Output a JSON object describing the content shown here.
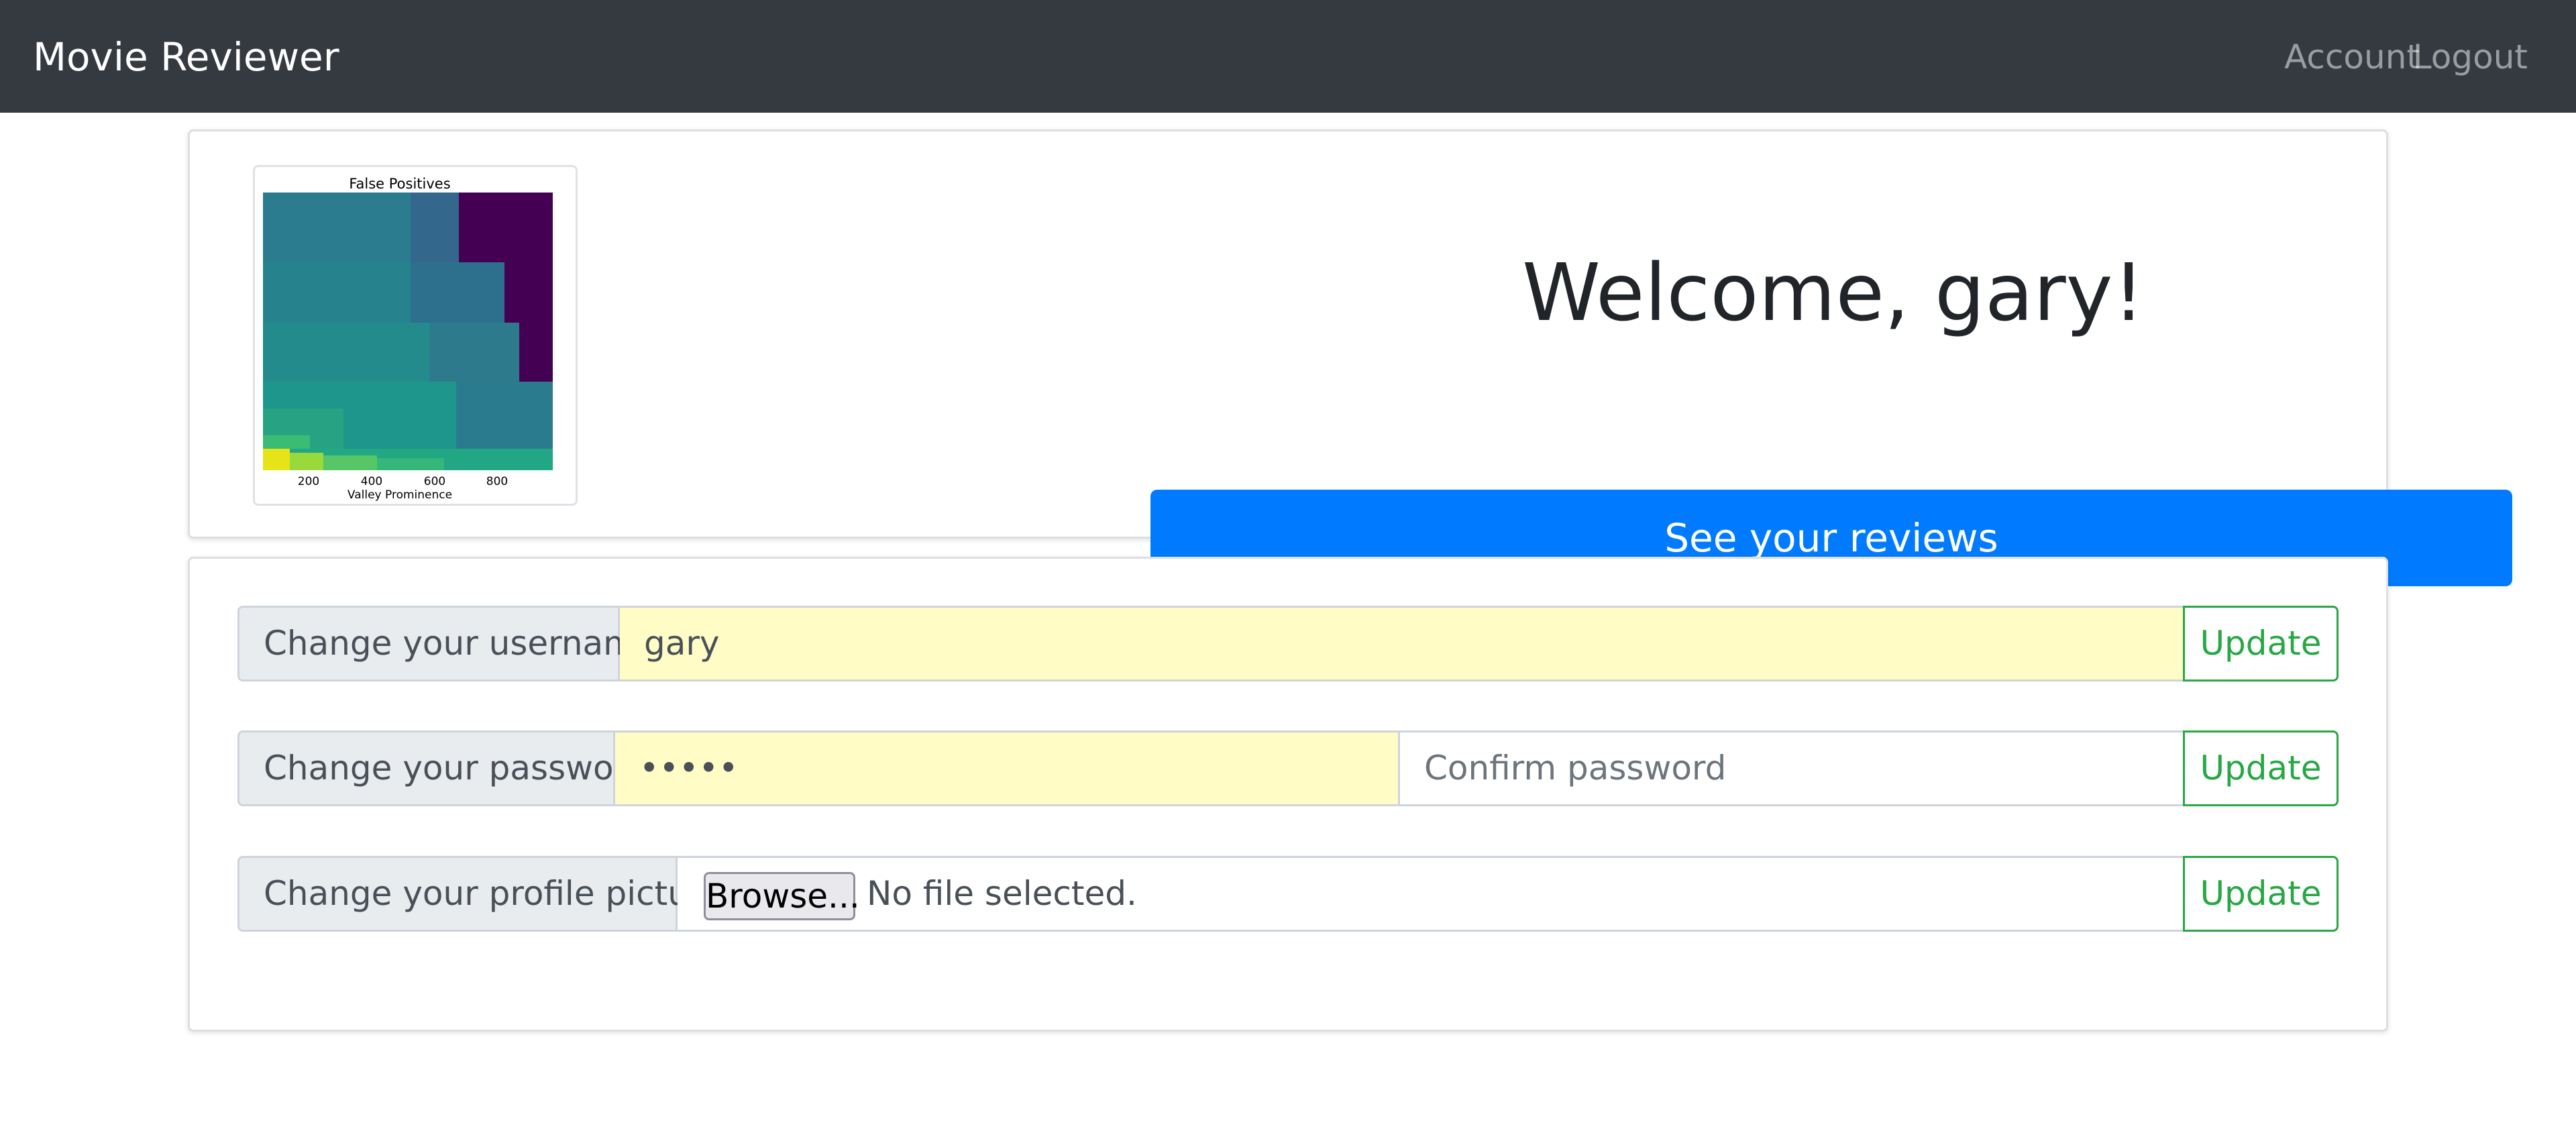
{
  "navbar": {
    "brand": "Movie Reviewer",
    "links": [
      "Account",
      "Logout"
    ]
  },
  "profile": {
    "avatar": {
      "title": "False Positives",
      "xlabel": "Valley Prominence",
      "x_ticks": [
        "200",
        "400",
        "600",
        "800"
      ],
      "colormap": "viridis"
    },
    "welcome": "Welcome, gary!",
    "reviews_button": "See your reviews"
  },
  "form": {
    "username": {
      "label": "Change your username",
      "value": "gary",
      "button": "Update"
    },
    "password": {
      "label": "Change your password",
      "value": "•••••",
      "confirm_placeholder": "Confirm password",
      "button": "Update"
    },
    "picture": {
      "label": "Change your profile picture",
      "browse": "Browse...",
      "status": "No file selected.",
      "button": "Update"
    }
  },
  "colors": {
    "navbar_bg": "#343a40",
    "primary": "#007bff",
    "success": "#28a745",
    "autofill_bg": "#fffcc6"
  }
}
